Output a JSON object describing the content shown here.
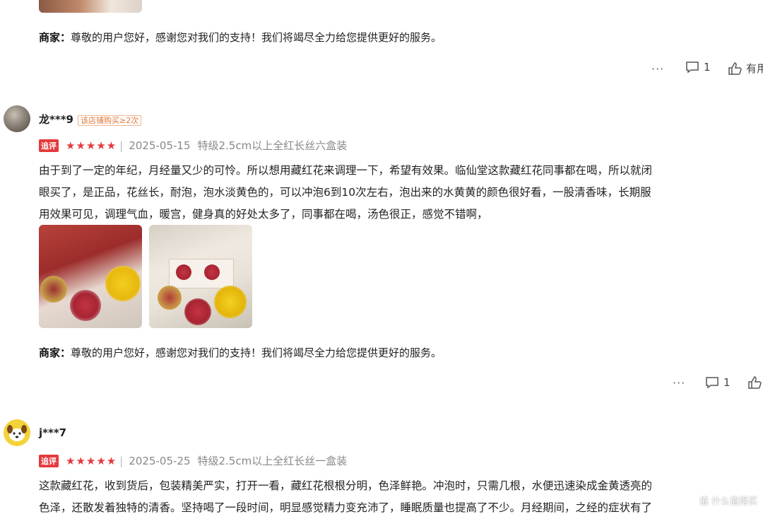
{
  "merchant_reply": {
    "label": "商家：",
    "text": "尊敬的用户您好，感谢您对我们的支持！我们将竭尽全力给您提供更好的服务。"
  },
  "review0_actions": {
    "more": "···",
    "comment_count": "1",
    "useful_label": "有用"
  },
  "review1": {
    "user": "龙***9",
    "repeat_tag": "该店铺购买≥2次",
    "badge": "追评",
    "stars": "★★★★★",
    "date": "2025-05-15",
    "spec": "特级2.5cm以上全红长丝六盒装",
    "lines": [
      "由于到了一定的年纪，月经量又少的可怜。所以想用藏红花来调理一下，希望有效果。临仙堂这款藏红花同事都在喝，所以就闭",
      "眼买了，是正品，花丝长，耐泡，泡水淡黄色的，可以冲泡6到10次左右，泡出来的水黄黄的颜色很好看，一股清香味，长期服",
      "用效果可见，调理气血，暖宫，健身真的好处太多了，同事都在喝，汤色很正，感觉不错啊，"
    ],
    "actions": {
      "more": "···",
      "comment_count": "1"
    }
  },
  "review2": {
    "user": "j***7",
    "badge": "追评",
    "stars": "★★★★★",
    "date": "2025-05-25",
    "spec": "特级2.5cm以上全红长丝一盒装",
    "lines": [
      "这款藏红花，收到货后，包装精美严实，打开一看，藏红花根根分明，色泽鲜艳。冲泡时，只需几根，水便迅速染成金黄透亮的",
      "色泽，还散发着独特的清香。坚持喝了一段时间，明显感觉精力变充沛了，睡眠质量也提高了不少。月经期间，之经的症状有了"
    ]
  },
  "watermark": "值 什么值得买",
  "colors": {
    "accent": "#e4393c",
    "text": "#222222",
    "meta": "#888888"
  }
}
